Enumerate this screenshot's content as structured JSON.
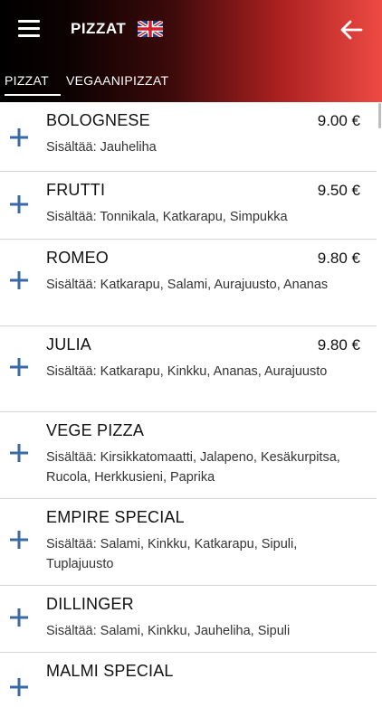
{
  "header": {
    "title": "PIZZAT",
    "flag_icon": "uk-flag-icon",
    "menu_icon": "hamburger-menu-icon",
    "back_icon": "arrow-left-icon",
    "gradient": [
      "#000000",
      "#ee4a44"
    ]
  },
  "tabs": [
    {
      "label": "PIZZAT",
      "active": true
    },
    {
      "label": "VEGAANIPIZZAT",
      "active": false
    }
  ],
  "accent_color": "#3a68a8",
  "items": [
    {
      "name": "BOLOGNESE",
      "price": "9.00 €",
      "desc": "Sisältää: Jauheliha"
    },
    {
      "name": "FRUTTI",
      "price": "9.50 €",
      "desc": "Sisältää: Tonnikala, Katkarapu, Simpukka"
    },
    {
      "name": "ROMEO",
      "price": "9.80 €",
      "desc": "Sisältää: Katkarapu, Salami, Aurajuusto, Ananas"
    },
    {
      "name": "JULIA",
      "price": "9.80 €",
      "desc": "Sisältää: Katkarapu, Kinkku, Ananas, Aurajuusto"
    },
    {
      "name": "VEGE PIZZA",
      "price": "",
      "desc": "Sisältää: Kirsikkatomaatti, Jalapeno, Kesäkurpitsa, Rucola, Herkkusieni, Paprika"
    },
    {
      "name": "EMPIRE SPECIAL",
      "price": "",
      "desc": "Sisältää: Salami, Kinkku, Katkarapu, Sipuli, Tuplajuusto"
    },
    {
      "name": "DILLINGER",
      "price": "",
      "desc": "Sisältää: Salami, Kinkku, Jauheliha, Sipuli"
    },
    {
      "name": "MALMI SPECIAL",
      "price": "",
      "desc": ""
    }
  ]
}
